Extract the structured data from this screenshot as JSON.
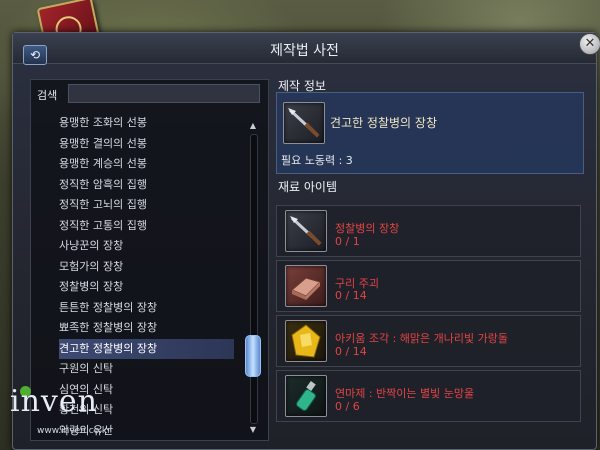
{
  "window": {
    "title": "제작법 사전"
  },
  "search": {
    "label": "검색",
    "value": ""
  },
  "recipe_list": [
    {
      "label": "용맹한 조화의 선봉",
      "selected": false
    },
    {
      "label": "용맹한 결의의 선봉",
      "selected": false
    },
    {
      "label": "용맹한 계승의 선봉",
      "selected": false
    },
    {
      "label": "정직한 암흑의 집행",
      "selected": false
    },
    {
      "label": "정직한 고뇌의 집행",
      "selected": false
    },
    {
      "label": "정직한 고통의 집행",
      "selected": false
    },
    {
      "label": "사냥꾼의 장창",
      "selected": false
    },
    {
      "label": "모험가의 장창",
      "selected": false
    },
    {
      "label": "정찰병의 장창",
      "selected": false
    },
    {
      "label": "튼튼한 정찰병의 장창",
      "selected": false
    },
    {
      "label": "뾰족한 정찰병의 장창",
      "selected": false
    },
    {
      "label": "견고한 정찰병의 장창",
      "selected": true
    },
    {
      "label": "구원의 신탁",
      "selected": false
    },
    {
      "label": "심연의 신탁",
      "selected": false
    },
    {
      "label": "황천의 신탁",
      "selected": false
    },
    {
      "label": "악령의 유산",
      "selected": false
    }
  ],
  "craft_info": {
    "heading": "제작 정보",
    "item_name": "견고한 정찰병의 장창",
    "item_icon": "spear-icon",
    "labor_text": "필요 노동력 : 3"
  },
  "materials": {
    "heading": "재료 아이템",
    "items": [
      {
        "name": "정찰병의 장창",
        "qty": "0 / 1",
        "icon": "spear-icon"
      },
      {
        "name": "구리 주괴",
        "qty": "0 / 14",
        "icon": "copper-ingot-icon"
      },
      {
        "name": "아키움 조각 : 해맑은 개나리빛 가랑돌",
        "qty": "0 / 14",
        "icon": "gem-shard-icon"
      },
      {
        "name": "연마제 : 반짝이는 별빛 눈망울",
        "qty": "0 / 6",
        "icon": "polish-vial-icon"
      }
    ]
  },
  "watermark": {
    "text": "inven",
    "url": "www.inven.co.kr"
  },
  "colors": {
    "required_red": "#e24444",
    "selection_blue": "#3d4a73",
    "panel_bg": "#23262f"
  }
}
